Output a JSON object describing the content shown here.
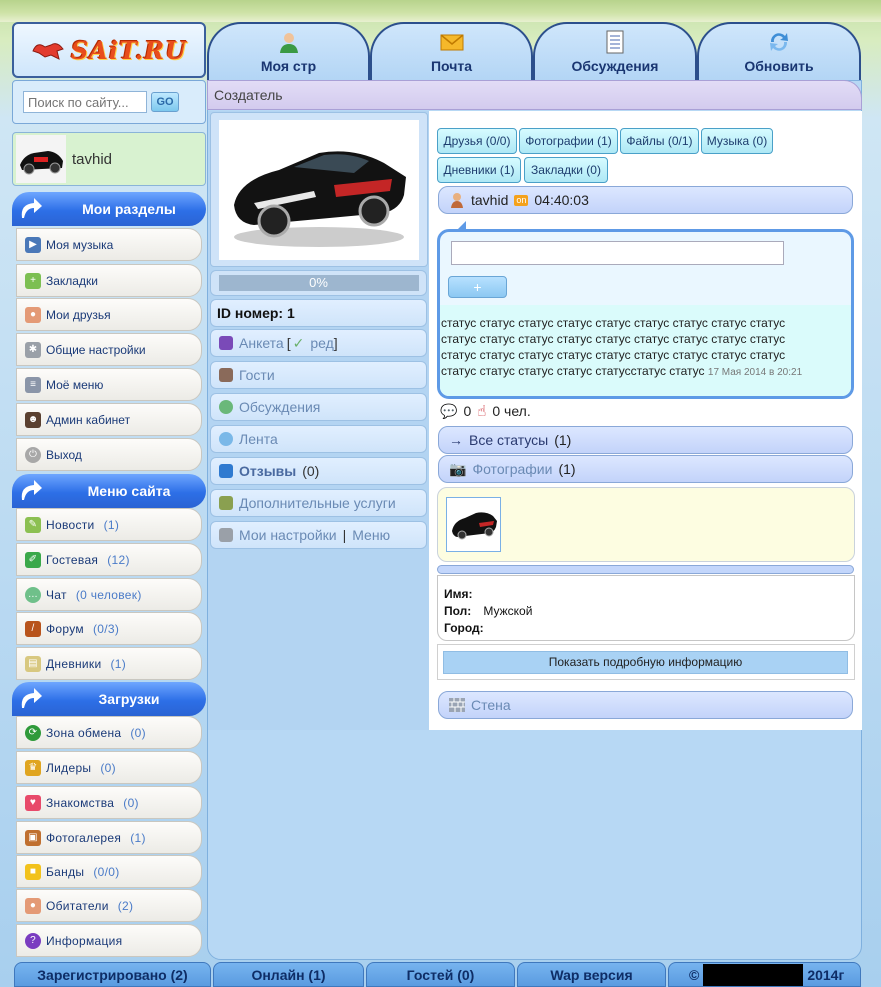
{
  "colors": {
    "accent": "#2d6fe7",
    "panel": "#b7d8f4",
    "status_border": "#5e9ae6"
  },
  "logo": {
    "text": "SAiT.RU"
  },
  "search": {
    "placeholder": "Поиск по сайту...",
    "button": "GO"
  },
  "user_card": {
    "username": "tavhid"
  },
  "sections": {
    "my": "Мои разделы",
    "site": "Меню сайта",
    "downloads": "Загрузки"
  },
  "my_menu": [
    {
      "label": "Моя музыка",
      "icon": "play-icon"
    },
    {
      "label": "Закладки",
      "icon": "bookmark-icon"
    },
    {
      "label": "Мои друзья",
      "icon": "friends-icon"
    },
    {
      "label": "Общие настройки",
      "icon": "gear-icon"
    },
    {
      "label": "Моё меню",
      "icon": "menu-icon"
    },
    {
      "label": "Админ кабинет",
      "icon": "admin-icon"
    },
    {
      "label": "Выход",
      "icon": "power-icon"
    }
  ],
  "site_menu": [
    {
      "label": "Новости",
      "count": "(1)",
      "icon": "news-icon"
    },
    {
      "label": "Гостевая",
      "count": "(12)",
      "icon": "guestbook-icon"
    },
    {
      "label": "Чат",
      "count": "(0 человек)",
      "icon": "chat-icon"
    },
    {
      "label": "Форум",
      "count": "(0/3)",
      "icon": "forum-icon"
    },
    {
      "label": "Дневники",
      "count": "(1)",
      "icon": "diary-icon"
    }
  ],
  "downloads_menu": [
    {
      "label": "Зона обмена",
      "count": "(0)",
      "icon": "exchange-icon"
    },
    {
      "label": "Лидеры",
      "count": "(0)",
      "icon": "trophy-icon"
    },
    {
      "label": "Знакомства",
      "count": "(0)",
      "icon": "heart-icon"
    },
    {
      "label": "Фотогалерея",
      "count": "(1)",
      "icon": "gallery-icon"
    },
    {
      "label": "Банды",
      "count": "(0/0)",
      "icon": "gang-icon"
    },
    {
      "label": "Обитатели",
      "count": "(2)",
      "icon": "users-icon"
    },
    {
      "label": "Информация",
      "icon": "info-icon"
    }
  ],
  "top_tabs": [
    {
      "label": "Моя стр",
      "icon": "user-icon"
    },
    {
      "label": "Почта",
      "icon": "mail-icon"
    },
    {
      "label": "Обсуждения",
      "icon": "notes-icon"
    },
    {
      "label": "Обновить",
      "icon": "refresh-icon"
    }
  ],
  "breadcrumb": "Создатель",
  "profile": {
    "progress_text": "0%",
    "progress_value": 0,
    "id_label": "ID номер: 1",
    "rows": {
      "anketa": "Анкета",
      "anketa_bracket_open": "[",
      "anketa_edit": "ред",
      "anketa_bracket_close": "]",
      "guests": "Гости",
      "discussions": "Обсуждения",
      "feed": "Лента",
      "reviews": "Отзывы",
      "reviews_count": "(0)",
      "extra_services": "Дополнительные услуги",
      "my_settings": "Мои настройки",
      "sep": "|",
      "menu": "Меню"
    }
  },
  "tags": [
    "Друзья (0/0)",
    "Фотографии (1)",
    "Файлы (0/1)",
    "Музыка (0)",
    "Дневники (1)",
    "Закладки (0)"
  ],
  "user_line": {
    "name": "tavhid",
    "online_badge": "on",
    "time": "04:40:03"
  },
  "status": {
    "add_button": "+",
    "text": "статус статус статус статус статус статус статус статус статус статус статус статус статус статус статус статус статус статус статус статус статус статус статус статус статус статус статус статус статус статус статус статусстатус статус",
    "date": "17 Мая 2014 в 20:21"
  },
  "likes": {
    "comments": "0",
    "people": "0 чел."
  },
  "all_statuses": {
    "label": "Все статусы",
    "count": "(1)",
    "arrow": "→"
  },
  "photos": {
    "label": "Фотографии",
    "count": "(1)"
  },
  "info": {
    "name_label": "Имя:",
    "name_value": "",
    "gender_label": "Пол:",
    "gender_value": "Мужской",
    "city_label": "Город:",
    "city_value": ""
  },
  "more_button": "Показать подробную информацию",
  "wall": "Стена",
  "footer": {
    "registered": "Зарегистрировано (2)",
    "online": "Онлайн (1)",
    "guests": "Гостей (0)",
    "wap": "Wap версия",
    "copyright_symbol": "©",
    "year": "2014г"
  }
}
